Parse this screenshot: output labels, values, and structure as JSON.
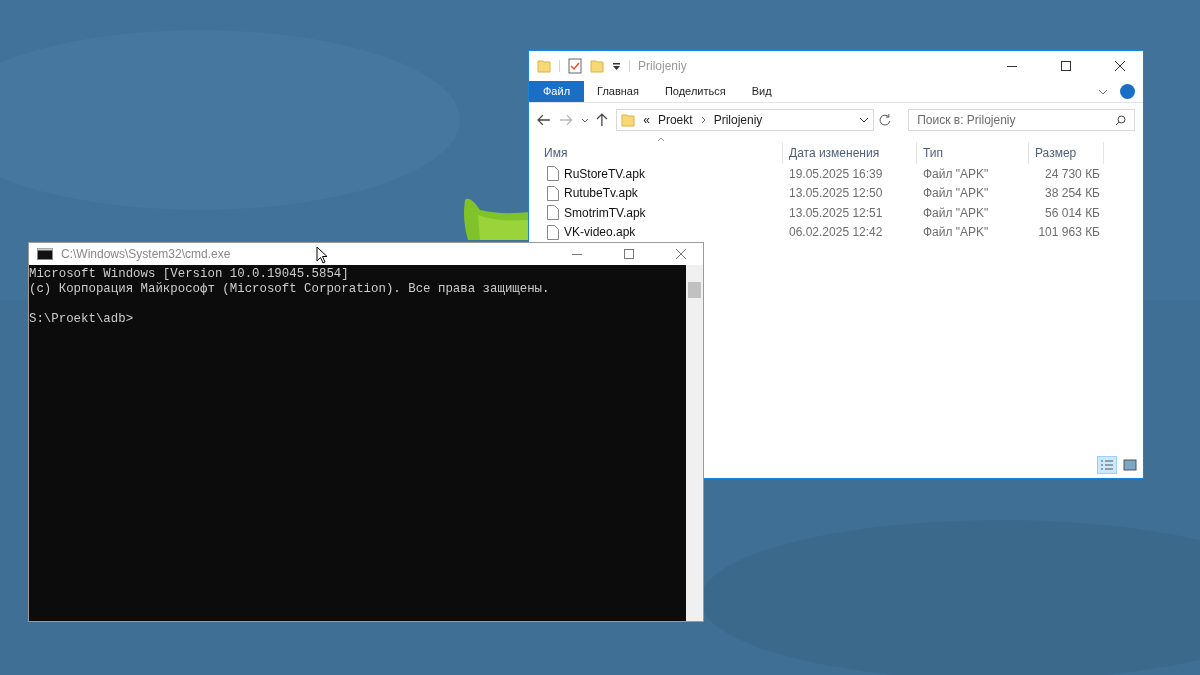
{
  "explorer": {
    "title": "Prilojeniy",
    "ribbon_tabs": [
      {
        "label": "Файл",
        "selected": true
      },
      {
        "label": "Главная",
        "selected": false
      },
      {
        "label": "Поделиться",
        "selected": false
      },
      {
        "label": "Вид",
        "selected": false
      }
    ],
    "breadcrumb": [
      "«",
      "Proekt",
      "Prilojeniy"
    ],
    "search": {
      "placeholder": "Поиск в: Prilojeniy"
    },
    "columns": [
      "Имя",
      "Дата изменения",
      "Тип",
      "Размер"
    ],
    "rows": [
      {
        "name": "RuStoreTV.apk",
        "date": "19.05.2025 16:39",
        "type": "Файл \"APK\"",
        "size": "24 730 КБ"
      },
      {
        "name": "RutubeTv.apk",
        "date": "13.05.2025 12:50",
        "type": "Файл \"APK\"",
        "size": "38 254 КБ"
      },
      {
        "name": "SmotrimTV.apk",
        "date": "13.05.2025 12:51",
        "type": "Файл \"APK\"",
        "size": "56 014 КБ"
      },
      {
        "name": "VK-video.apk",
        "date": "06.02.2025 12:42",
        "type": "Файл \"APK\"",
        "size": "101 963 КБ"
      }
    ]
  },
  "console": {
    "title": "C:\\Windows\\System32\\cmd.exe",
    "banner": [
      "Microsoft Windows [Version 10.0.19045.5854]",
      "(c) Корпорация Майкрософт (Microsoft Corporation). Все права защищены."
    ],
    "prompt": "S:\\Proekt\\adb>"
  }
}
